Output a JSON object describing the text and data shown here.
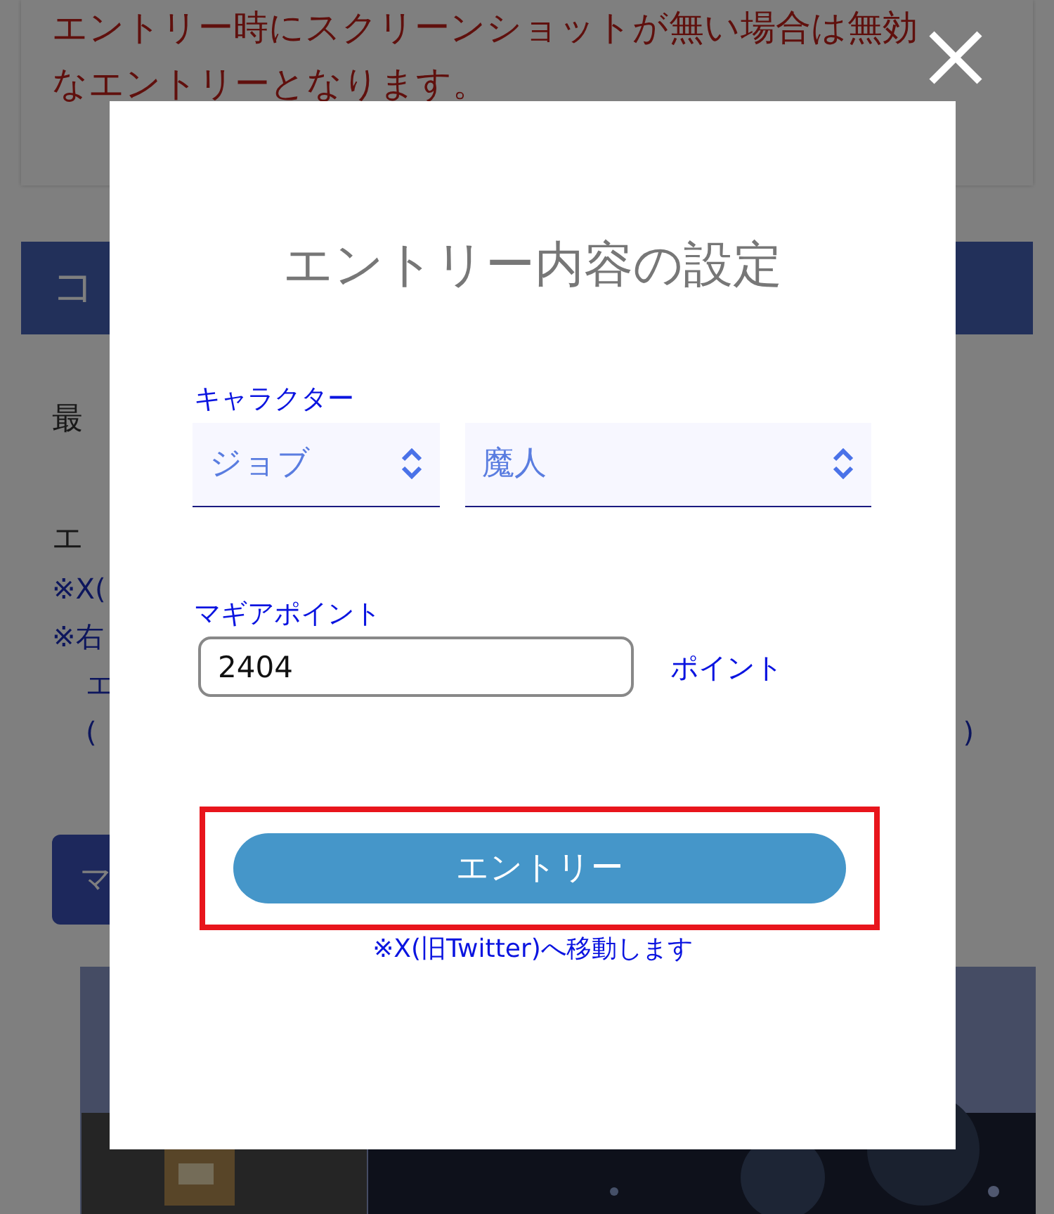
{
  "background": {
    "notice_lines": [
      "エントリー時にスクリーンショットが無い場合は無効",
      "なエントリーとなります。"
    ],
    "section_heading": "コ",
    "fragments": [
      {
        "kind": "body",
        "text": "最"
      },
      {
        "kind": "body-gap",
        "text": "エ"
      },
      {
        "kind": "note",
        "text": "※X("
      },
      {
        "kind": "note",
        "text": "※右"
      },
      {
        "kind": "note-indent",
        "text": "エ"
      },
      {
        "kind": "note-split",
        "text": "(",
        "tail": ")"
      }
    ],
    "button_fragment": "マ"
  },
  "modal": {
    "title": "エントリー内容の設定",
    "fields": [
      {
        "kind": "selects",
        "label": "キャラクター",
        "selects": [
          {
            "value": "ジョブ"
          },
          {
            "value": "魔人"
          }
        ]
      },
      {
        "kind": "number",
        "label": "マギアポイント",
        "value": "2404",
        "unit": "ポイント"
      }
    ],
    "submit": {
      "label": "エントリー",
      "highlighted": true
    },
    "note": "※X(旧Twitter)へ移動します"
  }
}
